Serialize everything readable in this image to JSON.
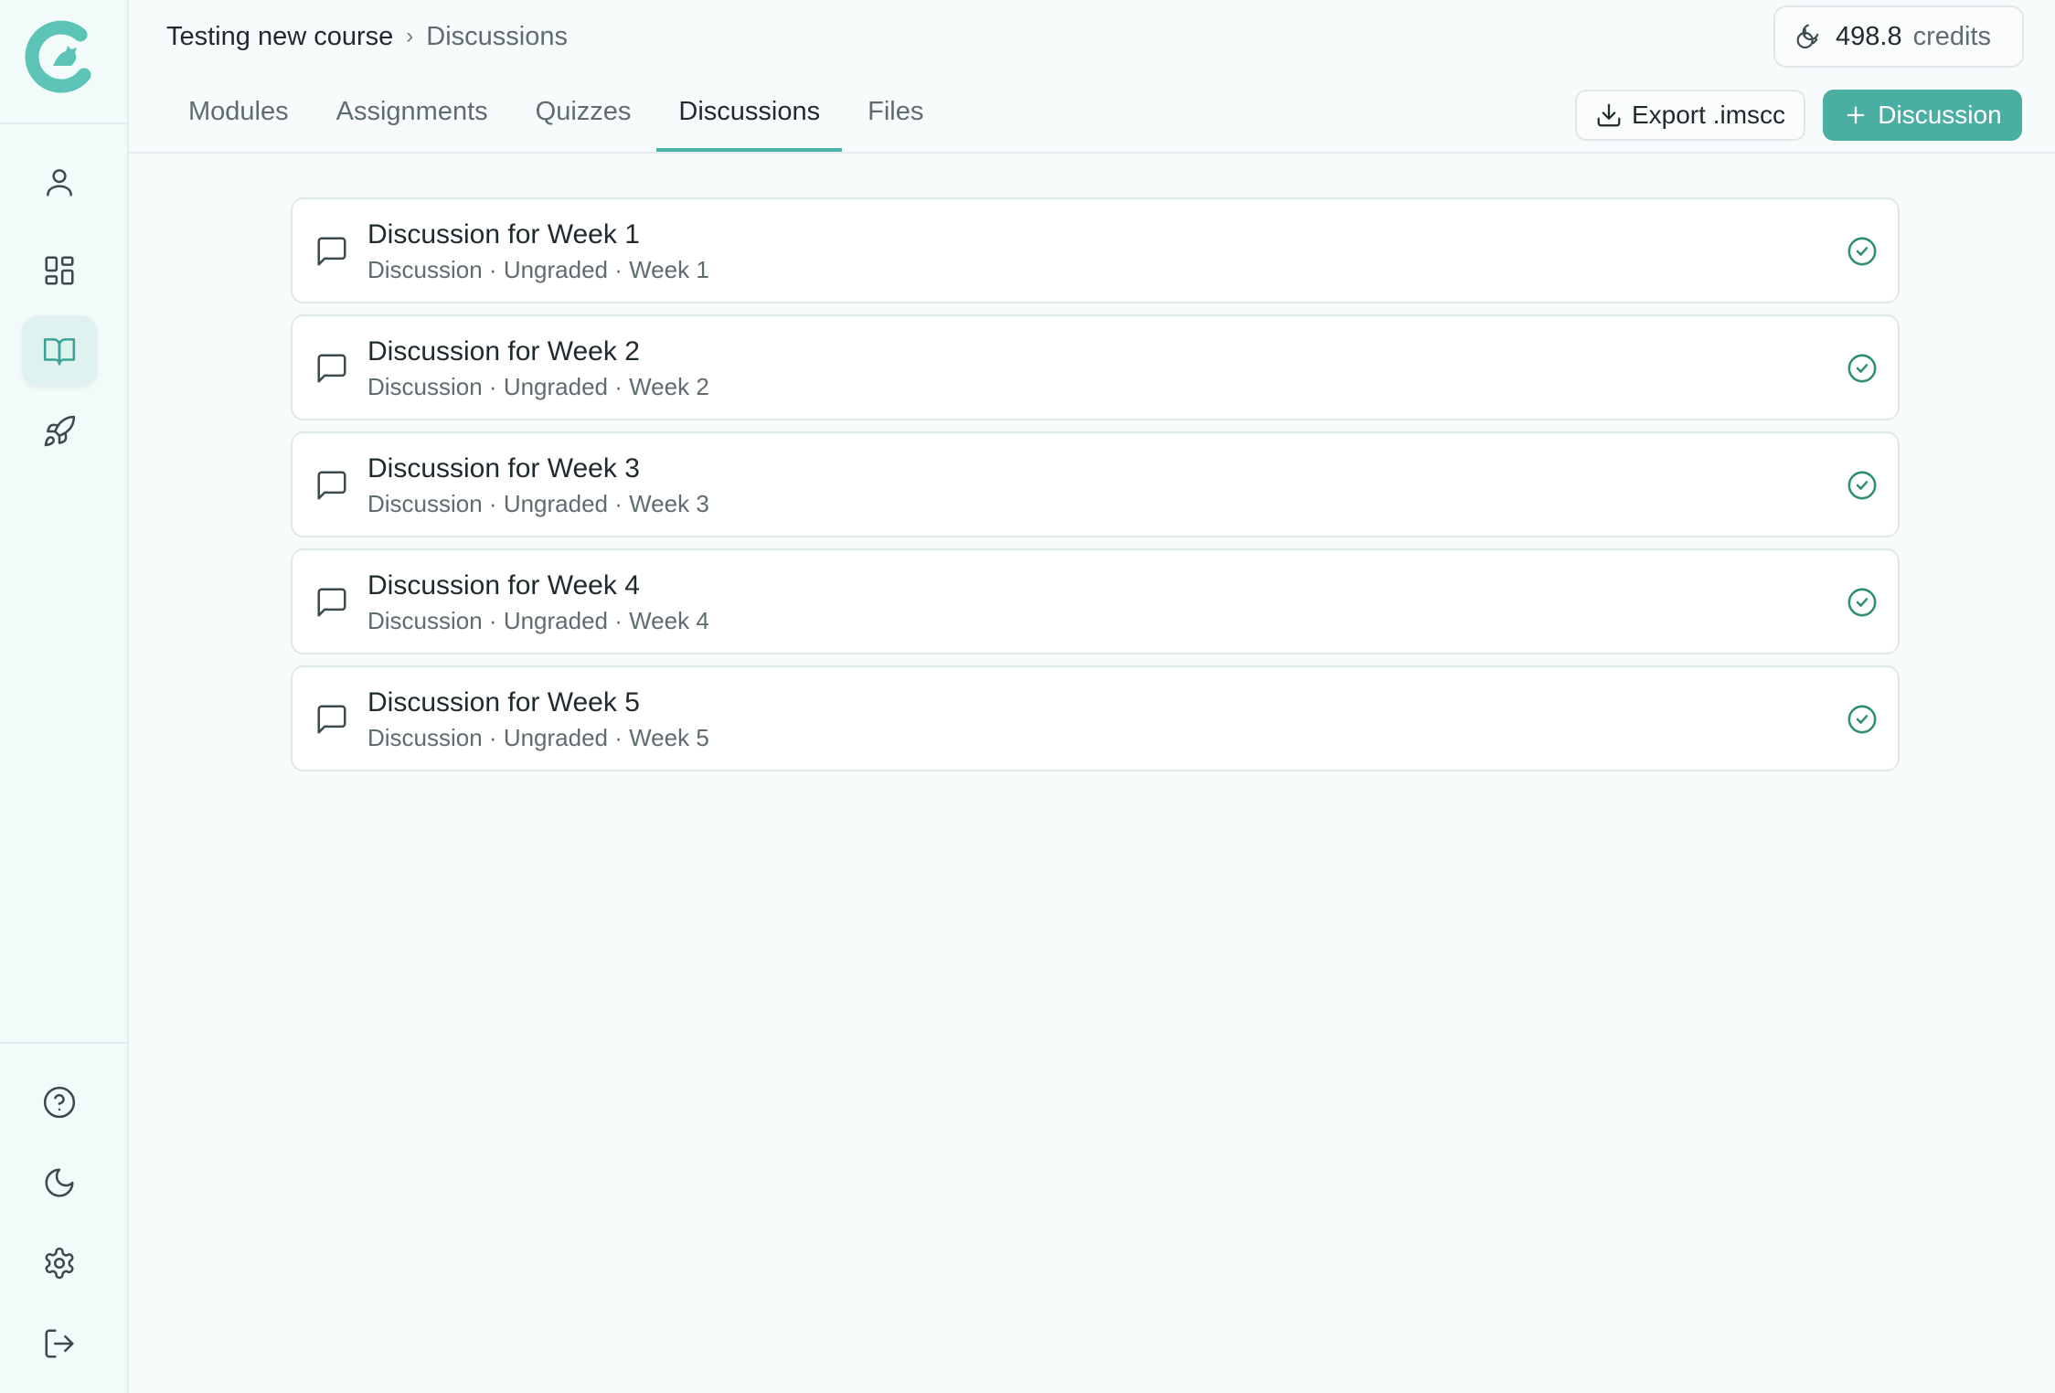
{
  "breadcrumb": {
    "course": "Testing new course",
    "separator": "›",
    "current": "Discussions"
  },
  "credits": {
    "amount": "498.8",
    "unit": "credits",
    "icon": "coins-icon"
  },
  "tabs": [
    {
      "label": "Modules",
      "active": false
    },
    {
      "label": "Assignments",
      "active": false
    },
    {
      "label": "Quizzes",
      "active": false
    },
    {
      "label": "Discussions",
      "active": true
    },
    {
      "label": "Files",
      "active": false
    }
  ],
  "actions": {
    "export_label": "Export .imscc",
    "add_label": "Discussion"
  },
  "sidebar": {
    "top_items": [
      "user-icon",
      "dashboard-icon",
      "book-open-icon",
      "rocket-icon"
    ],
    "active_item": "book-open-icon",
    "bottom_items": [
      "help-icon",
      "moon-icon",
      "gear-icon",
      "logout-icon"
    ]
  },
  "discussions": [
    {
      "title": "Discussion for Week 1",
      "meta": "Discussion · Ungraded · Week 1"
    },
    {
      "title": "Discussion for Week 2",
      "meta": "Discussion · Ungraded · Week 2"
    },
    {
      "title": "Discussion for Week 3",
      "meta": "Discussion · Ungraded · Week 3"
    },
    {
      "title": "Discussion for Week 4",
      "meta": "Discussion · Ungraded · Week 4"
    },
    {
      "title": "Discussion for Week 5",
      "meta": "Discussion · Ungraded · Week 5"
    }
  ],
  "colors": {
    "accent": "#4aaea3",
    "tab_underline": "#4bb3a7",
    "check": "#2e8f76",
    "logo": "#5cc3b7"
  }
}
